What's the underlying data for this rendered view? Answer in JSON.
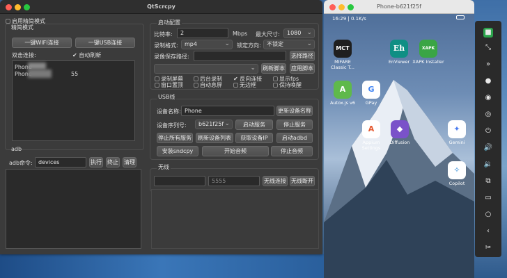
{
  "qt": {
    "title": "QtScrcpy",
    "enable_simple_mode": "启用精简模式",
    "simple_mode": "精简模式",
    "wifi_btn": "一键WIFI连接",
    "usb_btn": "一键USB连接",
    "double_connect": "双击连接:",
    "auto_refresh": "自动刷新",
    "device_list": [
      "Phone",
      "Phone",
      "55"
    ],
    "adb_group": "adb",
    "adb_cmd_label": "adb命令:",
    "adb_cmd_value": "devices",
    "execute": "执行",
    "stop": "终止",
    "clear": "清理",
    "start_config": "启动配置",
    "bitrate_label": "比特率:",
    "bitrate_value": "2",
    "bitrate_unit": "Mbps",
    "max_size_label": "最大尺寸:",
    "max_size_value": "1080",
    "record_format_label": "录制格式:",
    "record_format_value": "mp4",
    "lock_orient_label": "锁定方向:",
    "lock_orient_value": "不锁定",
    "record_path_label": "录像保存路径:",
    "select_path": "选择路径",
    "refresh_script": "刷新脚本",
    "apply_script": "应用脚本",
    "record_screen": "录制屏幕",
    "background_record": "后台录制",
    "reverse_connect": "反向连接",
    "show_fps": "显示fps",
    "window_top": "窗口置顶",
    "auto_off_screen": "自动息屏",
    "no_border": "无边框",
    "keep_awake": "保持唤醒",
    "usb_line": "USB线",
    "device_name_label": "设备名称:",
    "device_name_value": "Phone",
    "update_name": "更新设备名称",
    "serial_label": "设备序列号:",
    "serial_value": "b621f25f",
    "start_service": "启动服务",
    "stop_service": "停止服务",
    "stop_all": "停止所有服务",
    "refresh_devices": "刷新设备列表",
    "get_ip": "获取设备IP",
    "start_adbd": "启动adbd",
    "install_sndcpy": "安装sndcpy",
    "start_audio": "开始音频",
    "stop_audio": "停止音频",
    "wireless": "无线",
    "port_value": "5555",
    "wireless_connect": "无线连接",
    "wireless_disconnect": "无线断开"
  },
  "phone": {
    "title": "Phone-b621f25f",
    "status_bar": "16:29 | 0.1K/s",
    "apps": [
      {
        "name": "MIFARE Classic T...",
        "icon": "MCT",
        "color": "#1f1f1f"
      },
      {
        "name": "EnViewer",
        "icon": "Eh",
        "color": "#0f8f84"
      },
      {
        "name": "XAPK Installer",
        "icon": "XAPK",
        "color": "#3aa545"
      },
      {
        "name": "Autox.js v6",
        "icon": "A",
        "color": "#5fb94b"
      },
      {
        "name": "GPay",
        "icon": "G",
        "color": "#ffffff"
      },
      {
        "name": "Appium Settings",
        "icon": "A",
        "color": "#ffffff"
      },
      {
        "name": "Diffusion",
        "icon": "◆",
        "color": "#7a52c9"
      },
      {
        "name": "Gemini",
        "icon": "✦",
        "color": "#ffffff"
      },
      {
        "name": "Copilot",
        "icon": "✧",
        "color": "#ffffff"
      }
    ]
  },
  "colors": {
    "accent": "#28c840",
    "close": "#ff5f57",
    "minimize": "#febc2e"
  }
}
